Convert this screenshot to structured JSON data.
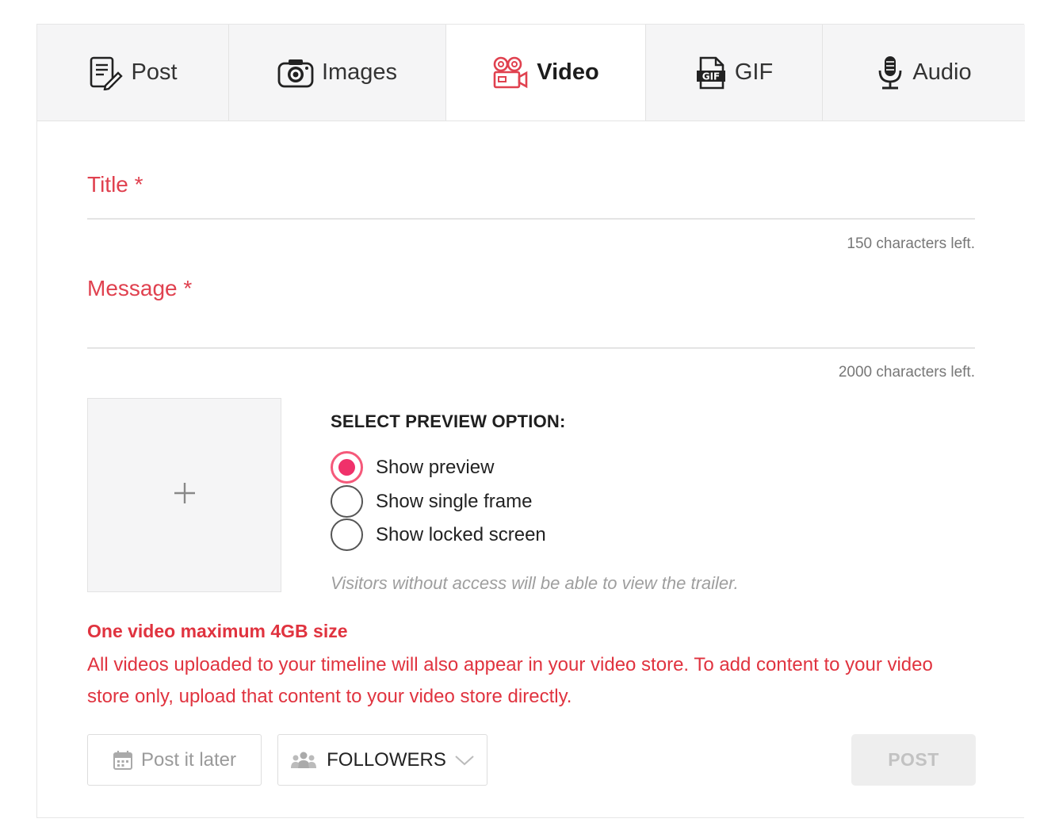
{
  "tabs": [
    {
      "id": "post",
      "label": "Post",
      "icon": "note-pencil-icon",
      "active": false
    },
    {
      "id": "images",
      "label": "Images",
      "icon": "camera-icon",
      "active": false
    },
    {
      "id": "video",
      "label": "Video",
      "icon": "film-camera-icon",
      "active": true
    },
    {
      "id": "gif",
      "label": "GIF",
      "icon": "gif-file-icon",
      "active": false
    },
    {
      "id": "audio",
      "label": "Audio",
      "icon": "microphone-icon",
      "active": false
    }
  ],
  "form": {
    "title_label": "Title *",
    "title_value": "",
    "title_counter": "150 characters left.",
    "message_label": "Message *",
    "message_value": "",
    "message_counter": "2000 characters left."
  },
  "preview": {
    "upload_icon": "plus-icon",
    "heading": "SELECT PREVIEW OPTION:",
    "options": [
      {
        "label": "Show preview",
        "checked": true
      },
      {
        "label": "Show single frame",
        "checked": false
      },
      {
        "label": "Show locked screen",
        "checked": false
      }
    ],
    "note": "Visitors without access will be able to view the trailer."
  },
  "limits": {
    "title": "One video maximum 4GB size",
    "text": "All videos uploaded to your timeline will also appear in your video store. To add content to your video store only, upload that content to your video store directly."
  },
  "actions": {
    "later_label": "Post it later",
    "audience_label": "FOLLOWERS",
    "post_label": "POST"
  },
  "colors": {
    "accent": "#e0414f",
    "radio_checked": "#f0316a",
    "tab_background": "#f5f5f6"
  }
}
